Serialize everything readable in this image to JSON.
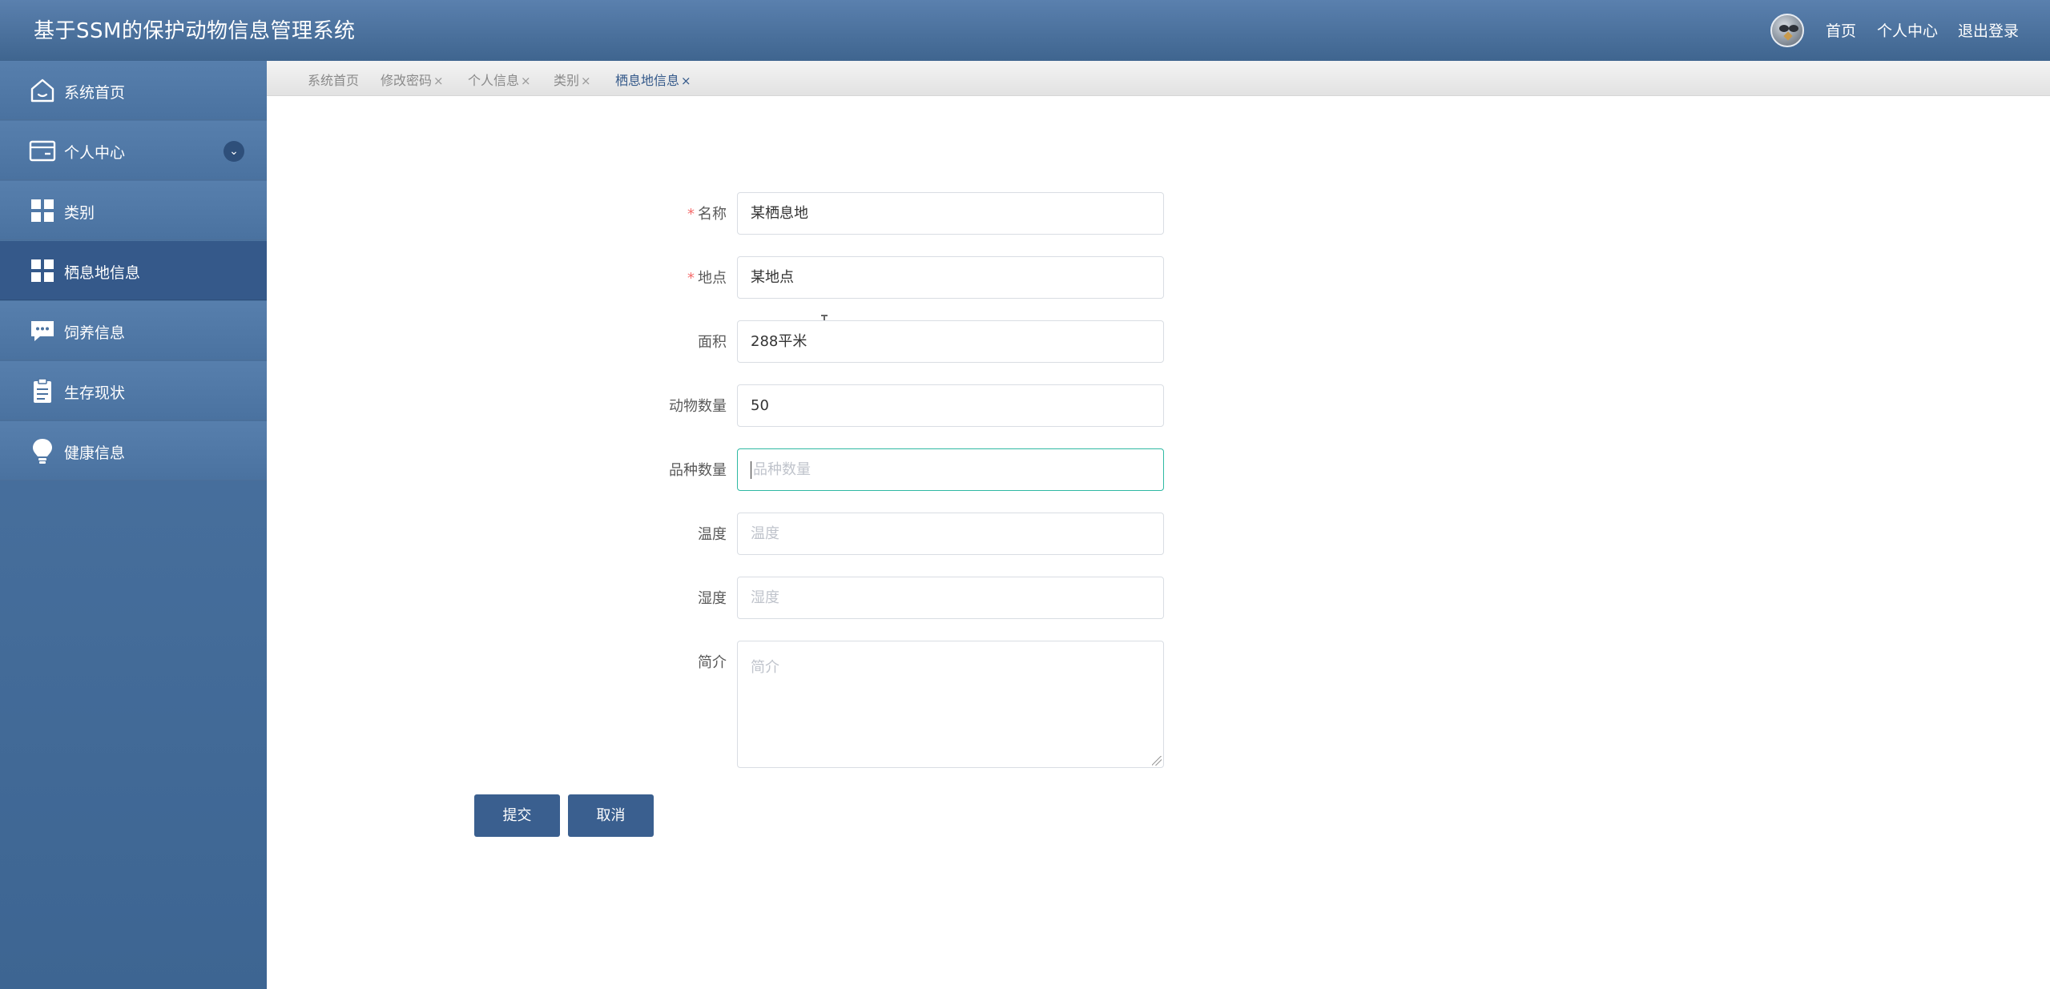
{
  "header": {
    "title": "基于SSM的保护动物信息管理系统",
    "links": [
      "首页",
      "个人中心",
      "退出登录"
    ]
  },
  "sidebar": {
    "items": [
      {
        "label": "系统首页",
        "icon": "home-icon"
      },
      {
        "label": "个人中心",
        "icon": "wallet-icon",
        "expandable": true
      },
      {
        "label": "类别",
        "icon": "grid-icon"
      },
      {
        "label": "栖息地信息",
        "icon": "grid-icon",
        "active": true
      },
      {
        "label": "饲养信息",
        "icon": "chat-icon"
      },
      {
        "label": "生存现状",
        "icon": "clipboard-icon"
      },
      {
        "label": "健康信息",
        "icon": "bulb-icon"
      }
    ]
  },
  "tabs": [
    {
      "label": "系统首页",
      "closable": false
    },
    {
      "label": "修改密码",
      "closable": true
    },
    {
      "label": "个人信息",
      "closable": true
    },
    {
      "label": "类别",
      "closable": true
    },
    {
      "label": "栖息地信息",
      "closable": true,
      "active": true
    }
  ],
  "tab_close_glyph": "×",
  "required_mark": "*",
  "form": {
    "fields": [
      {
        "label": "名称",
        "value": "某栖息地",
        "required": true
      },
      {
        "label": "地点",
        "value": "某地点",
        "required": true
      },
      {
        "label": "面积",
        "value": "288平米"
      },
      {
        "label": "动物数量",
        "value": "50"
      },
      {
        "label": "品种数量",
        "value": "",
        "placeholder": "品种数量",
        "focused": true
      },
      {
        "label": "温度",
        "value": "",
        "placeholder": "温度"
      },
      {
        "label": "湿度",
        "value": "",
        "placeholder": "湿度"
      }
    ],
    "intro": {
      "label": "简介",
      "placeholder": "简介"
    },
    "submit_label": "提交",
    "cancel_label": "取消"
  },
  "colors": {
    "header": "#4a709d",
    "sidebar_active": "#35598a",
    "button": "#3a5f8f",
    "focus_border": "#2fb9a3",
    "required": "#f56c6c"
  }
}
